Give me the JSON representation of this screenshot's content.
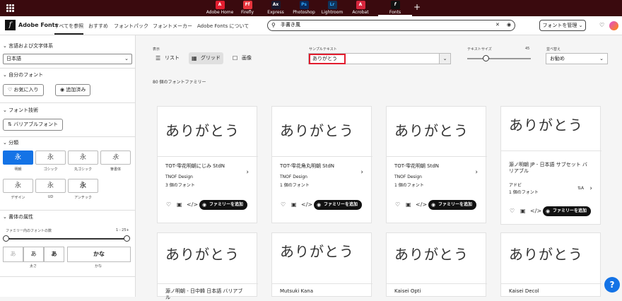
{
  "apps": [
    {
      "name": "Adobe Home",
      "abbr": "A",
      "color": "#e21d2f"
    },
    {
      "name": "Firefly",
      "abbr": "Ff",
      "color": "#e8343c"
    },
    {
      "name": "Express",
      "abbr": "Ax",
      "color": "#1a1a2e"
    },
    {
      "name": "Photoshop",
      "abbr": "Ps",
      "color": "#0a2a5c"
    },
    {
      "name": "Lightroom",
      "abbr": "Lr",
      "color": "#10335a"
    },
    {
      "name": "Acrobat",
      "abbr": "A",
      "color": "#d7263d"
    },
    {
      "name": "Fonts",
      "abbr": "f",
      "color": "#111111"
    }
  ],
  "header": {
    "brand": "Adobe Fonts",
    "nav": [
      "すべてを参照",
      "おすすめ",
      "フォントパック",
      "フォントメーカー",
      "Adobe Fonts について"
    ],
    "search_value": "手書き風",
    "manage": "フォントを管理"
  },
  "sidebar": {
    "lang_title": "言語および文字体系",
    "lang_value": "日本語",
    "my_fonts_title": "自分のフォント",
    "fav": "お気に入り",
    "added": "追加済み",
    "tech_title": "フォント技術",
    "variable": "バリアブルフォント",
    "class_title": "分類",
    "classes": [
      {
        "glyph": "永",
        "label": "明朝"
      },
      {
        "glyph": "永",
        "label": "ゴシック"
      },
      {
        "glyph": "永",
        "label": "丸ゴシック"
      },
      {
        "glyph": "永",
        "label": "筆書体"
      },
      {
        "glyph": "永",
        "label": "デザイン"
      },
      {
        "glyph": "永",
        "label": "UD"
      },
      {
        "glyph": "永",
        "label": "アンチック"
      }
    ],
    "attr_title": "書体の属性",
    "family_count_label": "ファミリー内のフォントの数",
    "family_count_range": "1 - 25+",
    "weights": [
      "あ",
      "あ",
      "あ"
    ],
    "weight_label": "太さ",
    "kana": "かな",
    "kana_label": "かな"
  },
  "toolbar": {
    "view_label": "表示",
    "list": "リスト",
    "grid": "グリッド",
    "image": "画像",
    "sample_label": "サンプルテキスト",
    "sample_value": "ありがとう",
    "size_label": "テキストサイズ",
    "size_value": "45",
    "sort_label": "並べ替え",
    "sort_value": "お勧め"
  },
  "family_count": "80 個のフォントファミリー",
  "cards": [
    {
      "sample": "ありがとう",
      "name": "TOT-雫花明朝にじみ StdN",
      "foundry": "TNOF Design",
      "count": "3 個のフォント",
      "add": "ファミリーを追加"
    },
    {
      "sample": "ありがとう",
      "name": "TOT-雫花角丸明朝 StdN",
      "foundry": "TNOF Design",
      "count": "1 個のフォント",
      "add": "ファミリーを追加"
    },
    {
      "sample": "ありがとう",
      "name": "TOT-雫花明朝 StdN",
      "foundry": "TNOF Design",
      "count": "1 個のフォント",
      "add": "ファミリーを追加"
    },
    {
      "sample": "ありがとう",
      "name": "源ノ明朝 JP - 日本語 サブセット バリアブル",
      "foundry": "アドビ",
      "count": "1 個のフォント",
      "add": "ファミリーを追加"
    },
    {
      "sample": "ありがとう",
      "name": "源ノ明朝 - 日中韓 日本語 バリアブル"
    },
    {
      "sample": "ありがとう",
      "name": "Mutsuki Kana"
    },
    {
      "sample": "ありがとう",
      "name": "Kaisei Opti"
    },
    {
      "sample": "ありがとう",
      "name": "Kaisei Decol"
    }
  ],
  "help": "?"
}
